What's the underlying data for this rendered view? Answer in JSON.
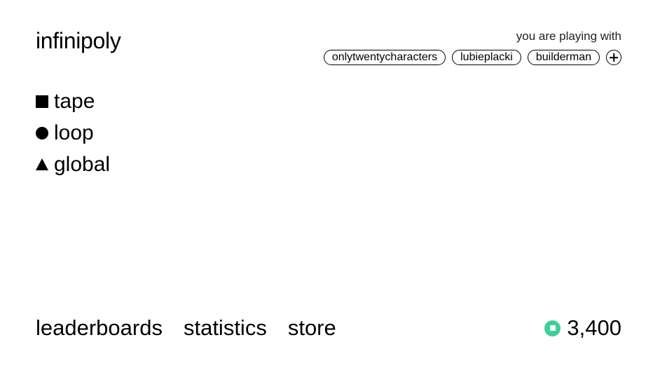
{
  "app": {
    "title": "infinipoly"
  },
  "players": {
    "label": "you are playing with",
    "list": [
      "onlytwentycharacters",
      "lubieplacki",
      "builderman"
    ],
    "add_icon": "plus-circle-icon"
  },
  "modes": [
    {
      "icon": "square-icon",
      "label": "tape"
    },
    {
      "icon": "circle-icon",
      "label": "loop"
    },
    {
      "icon": "triangle-icon",
      "label": "global"
    }
  ],
  "nav": {
    "leaderboards": "leaderboards",
    "statistics": "statistics",
    "store": "store"
  },
  "balance": {
    "icon": "coin-icon",
    "icon_color": "#3ccf9a",
    "value": "3,400"
  }
}
